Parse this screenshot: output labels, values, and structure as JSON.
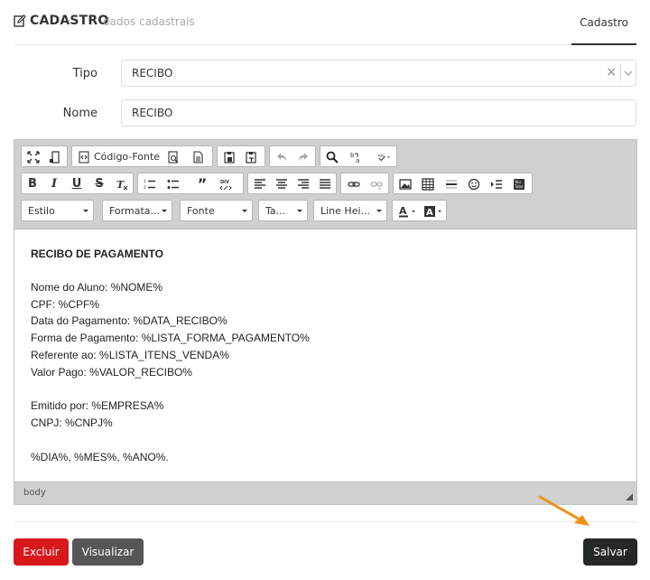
{
  "header": {
    "title": "CADASTRO",
    "subtitle": "dados cadastrais",
    "tab": "Cadastro"
  },
  "form": {
    "tipo_label": "Tipo",
    "tipo_value": "RECIBO",
    "nome_label": "Nome",
    "nome_value": "RECIBO"
  },
  "editor": {
    "toolbar": {
      "source_label": "Código-Fonte",
      "combos": [
        "Estilo",
        "Formata...",
        "Fonte",
        "Ta...",
        "Line Hei..."
      ],
      "icons_row1": [
        "maximize-icon",
        "show-blocks-icon",
        "source-icon",
        "preview-icon",
        "templates-icon",
        "paste-icon",
        "paste-text-icon",
        "undo-icon",
        "redo-icon",
        "find-icon",
        "replace-icon",
        "spellcheck-icon"
      ],
      "icons_row2": [
        "bold-icon",
        "italic-icon",
        "underline-icon",
        "strike-icon",
        "remove-format-icon",
        "numbered-list-icon",
        "bulleted-list-icon",
        "blockquote-icon",
        "div-icon",
        "align-left-icon",
        "align-center-icon",
        "align-right-icon",
        "justify-icon",
        "link-icon",
        "unlink-icon",
        "image-icon",
        "table-icon",
        "horizontal-rule-icon",
        "smiley-icon",
        "page-break-icon",
        "youtube-icon"
      ],
      "icons_row3": [
        "text-color-icon",
        "background-color-icon"
      ]
    },
    "content": {
      "title": "RECIBO DE PAGAMENTO",
      "line1": "Nome do Aluno: %NOME%",
      "line2": "CPF: %CPF%",
      "line3": "Data do Pagamento: %DATA_RECIBO%",
      "line4": "Forma de Pagamento: %LISTA_FORMA_PAGAMENTO%",
      "line5": "Referente ao: %LISTA_ITENS_VENDA%",
      "line6": "Valor Pago: %VALOR_RECIBO%",
      "line7": "Emitido por: %EMPRESA%",
      "line8": "CNPJ: %CNPJ%",
      "line9": "%DIA%, %MES%, %ANO%."
    },
    "status": "body"
  },
  "buttons": {
    "excluir": "Excluir",
    "visualizar": "Visualizar",
    "salvar": "Salvar"
  },
  "colors": {
    "excluir": "#d9181c",
    "visualizar": "#555655",
    "salvar": "#252925",
    "arrow": "#f0901c"
  }
}
